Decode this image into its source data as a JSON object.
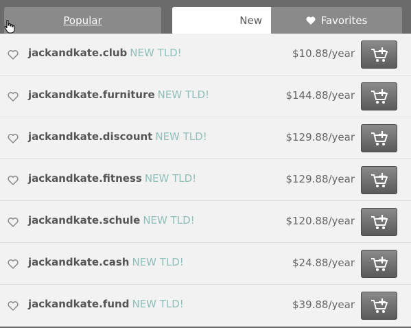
{
  "tabs": {
    "popular": "Popular",
    "new": "New",
    "favorites": "Favorites"
  },
  "tld_tag": "NEW TLD!",
  "domains": [
    {
      "name": "jackandkate.club",
      "price": "$10.88/year"
    },
    {
      "name": "jackandkate.furniture",
      "price": "$144.88/year"
    },
    {
      "name": "jackandkate.discount",
      "price": "$129.88/year"
    },
    {
      "name": "jackandkate.fitness",
      "price": "$129.88/year"
    },
    {
      "name": "jackandkate.schule",
      "price": "$120.88/year"
    },
    {
      "name": "jackandkate.cash",
      "price": "$24.88/year"
    },
    {
      "name": "jackandkate.fund",
      "price": "$39.88/year"
    }
  ],
  "icons": {
    "favorite": "heart-outline-icon",
    "cart": "add-to-cart-icon",
    "cursor": "hand-pointer-icon"
  },
  "colors": {
    "tld_tag": "#8fbfb8",
    "active_tab": "#ffffff",
    "inactive_tab": "#8a8a8a"
  }
}
